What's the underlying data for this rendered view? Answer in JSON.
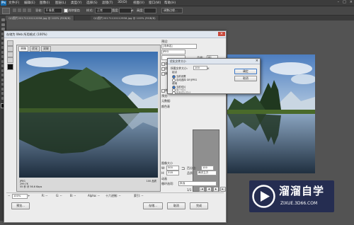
{
  "app": {
    "logo": "Ps"
  },
  "menubar": {
    "items": [
      "文件(F)",
      "编辑(E)",
      "图像(I)",
      "图层(L)",
      "类型(Y)",
      "选择(S)",
      "滤镜(T)",
      "3D(D)",
      "视图(V)",
      "窗口(W)",
      "帮助(H)"
    ]
  },
  "optbar": {
    "feather_label": "羽化:",
    "feather_value": "0 像素",
    "antialias_label": "消除锯齿",
    "style_label": "样式:",
    "style_value": "正常",
    "width_label": "宽度:",
    "height_label": "高度:",
    "refine_button": "调整边缘..."
  },
  "tabs": [
    "QQ图片20171120112056.jpg @ 100% (RGB/8)",
    "QQ图片20171120112958.jpg @ 100% (RGB/8)"
  ],
  "dialog": {
    "title": "存储为 Web 所用格式 (100%)",
    "subtabs": [
      "原稿",
      "优化",
      "双联"
    ],
    "preset_label": "预设:",
    "preset_value": "[未命名]",
    "format_value": "JPEG",
    "quality_label": "品质:",
    "quality_value": "60",
    "options": [
      "连续",
      "优化",
      "嵌入颜色配置文件"
    ],
    "blur_label": "模糊:",
    "matte_label": "杂边:",
    "convert_label": "转换为 sRGB",
    "preview_label": "预览:",
    "metadata_label": "元数据:",
    "color_table_label": "颜色表",
    "image_size_label": "图像大小",
    "w_label": "W:",
    "w_value": "500",
    "h_label": "H:",
    "h_value": "318",
    "percent_label": "百分比:",
    "percent_value": "100",
    "quality_resample_label": "品质:",
    "quality_resample_value": "两次立方",
    "animation_label": "动画",
    "loop_label": "循环选项:",
    "loop_value": "永远",
    "frame_counter": "1/1",
    "preview_info_left": [
      "JPEG",
      "299.7K",
      "55 秒 @ 56.6 Kbps"
    ],
    "preview_info_right": [
      "100 品质"
    ],
    "zoom_value": "100%",
    "status_r": "R: --",
    "status_g": "G: --",
    "status_b": "B: --",
    "status_alpha": "Alpha: --",
    "status_hex": "十六进制: --",
    "status_index": "索引: --",
    "preview_button": "预览...",
    "save_button": "存储...",
    "cancel_button": "取消",
    "done_button": "完成"
  },
  "modal": {
    "title": "优化文件大小",
    "target_label": "所需文件大小:",
    "target_value": "100",
    "unit": "K",
    "start_label": "起点",
    "opt_current": "当前设置",
    "opt_auto": "自动选择 GIF/JPEG",
    "use_label": "使用",
    "opt_cur_slice": "当前切片",
    "opt_each_slice": "每个切片",
    "opt_all_slices": "所有切片总计",
    "ok_button": "确定",
    "cancel_button": "取消"
  },
  "watermark": {
    "big": "溜溜自学",
    "small": "ZIXUE.3D66.COM"
  }
}
